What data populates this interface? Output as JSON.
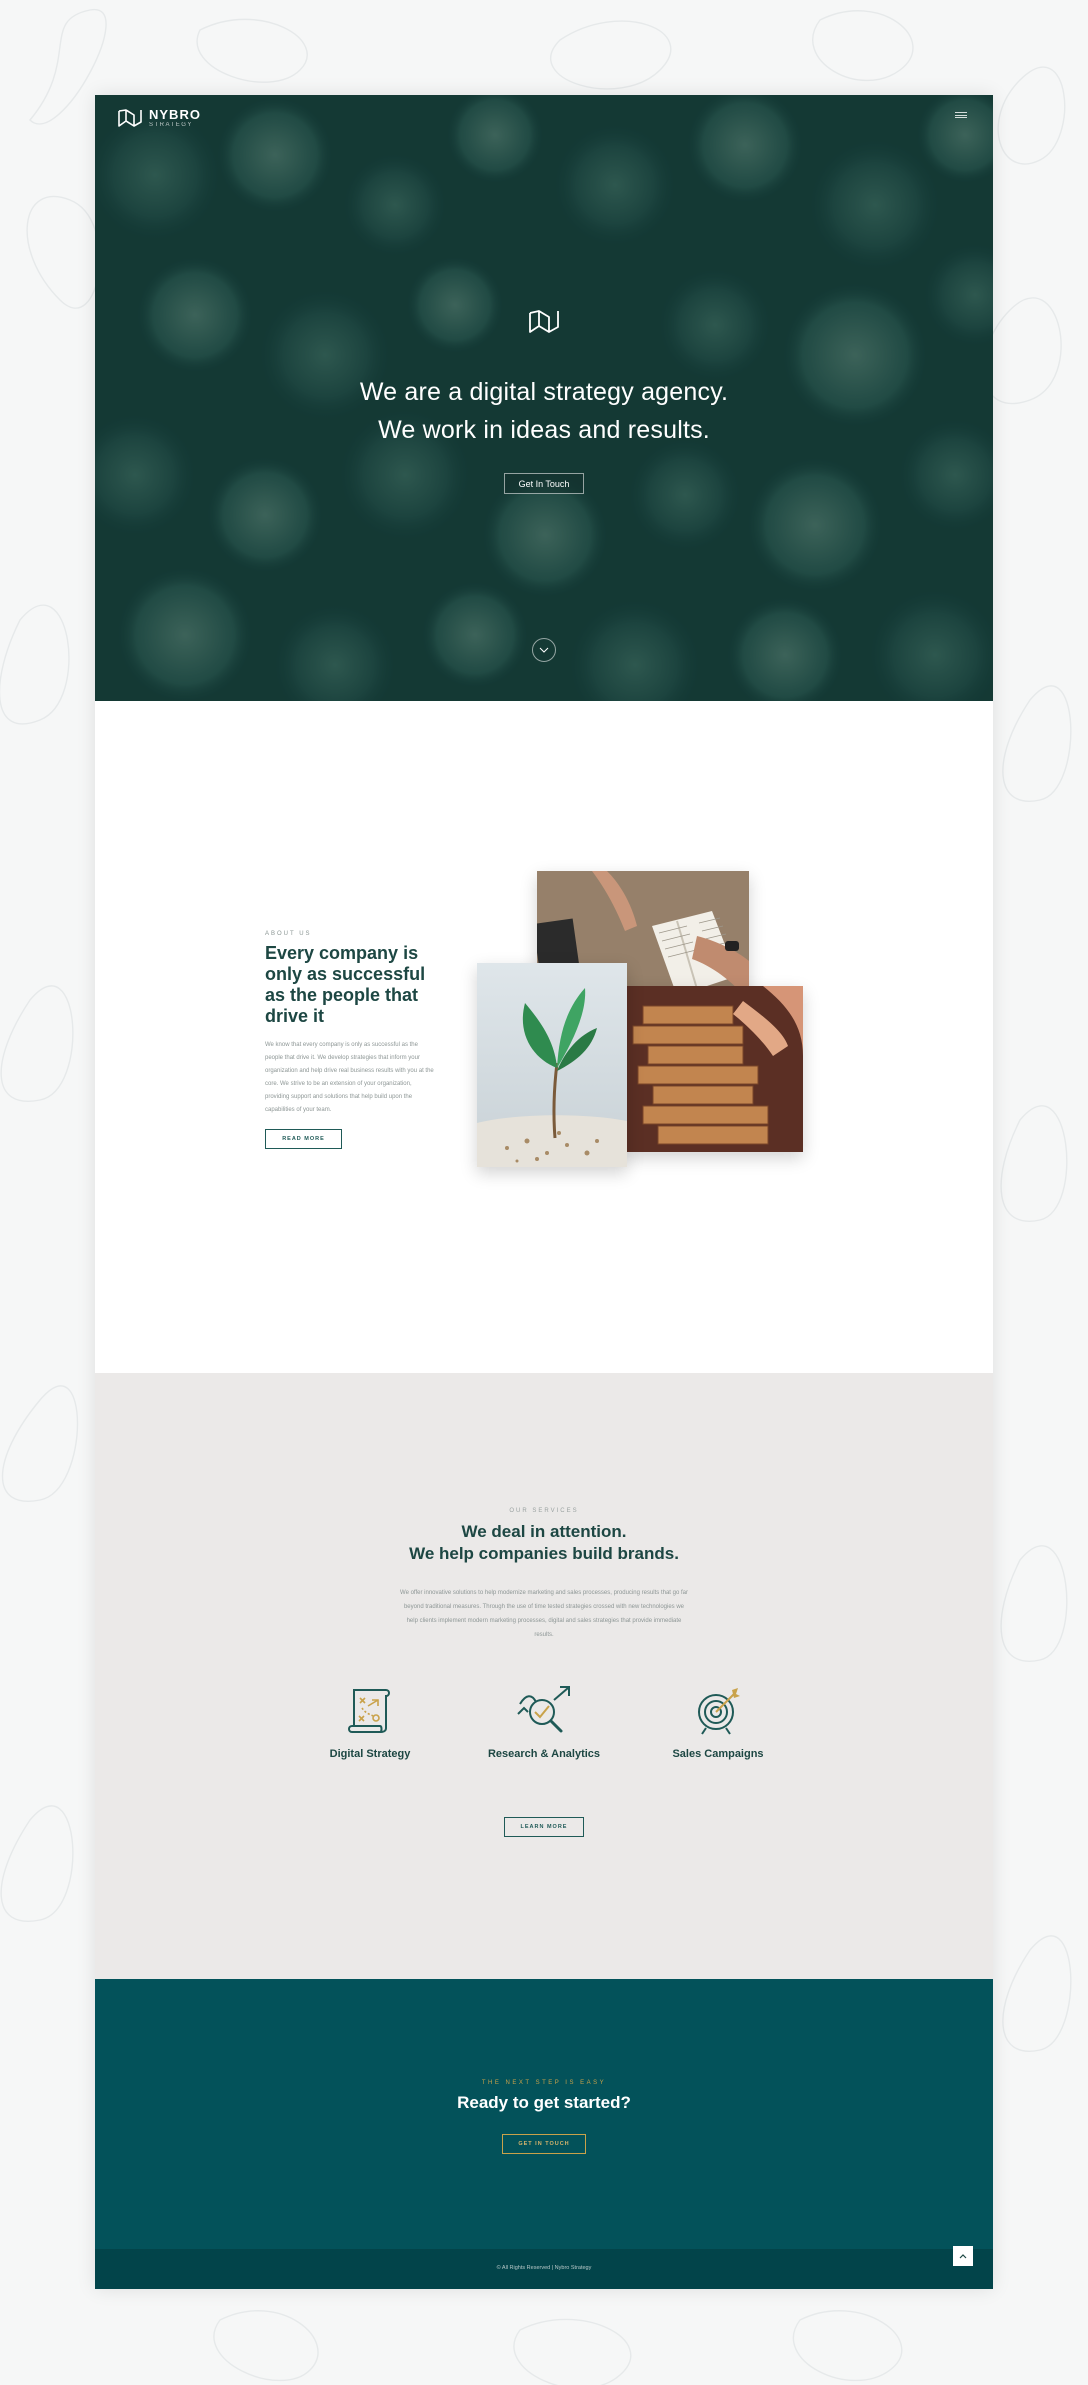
{
  "brand": {
    "name": "NYBRO",
    "tagline": "STRATEGY"
  },
  "hero": {
    "headline_line1": "We are a digital strategy agency.",
    "headline_line2": "We work in ideas and results.",
    "cta_label": "Get In Touch"
  },
  "about": {
    "eyebrow": "ABOUT US",
    "heading": "Every company is only as successful as the people that drive it",
    "body": "We know that every company is only as successful as the people that drive it. We develop strategies that inform your organization and help drive real business results with you at the core. We strive to be an extension of your organization, providing support and solutions that help build upon the capabilities of your team.",
    "button_label": "READ MORE"
  },
  "services": {
    "eyebrow": "OUR SERVICES",
    "heading_line1": "We deal in attention.",
    "heading_line2": "We help companies build brands.",
    "body": "We offer innovative solutions to help modernize marketing and sales processes, producing results that go far beyond traditional measures. Through the use of time tested strategies crossed with new technologies we help clients implement modern marketing processes, digital and sales strategies that provide immediate results.",
    "items": [
      {
        "label": "Digital Strategy",
        "icon": "strategy-map-icon"
      },
      {
        "label": "Research & Analytics",
        "icon": "research-analytics-icon"
      },
      {
        "label": "Sales Campaigns",
        "icon": "target-icon"
      }
    ],
    "button_label": "LEARN MORE"
  },
  "cta": {
    "eyebrow": "THE NEXT STEP IS EASY",
    "heading": "Ready to get started?",
    "button_label": "GET IN TOUCH"
  },
  "footer": {
    "copyright": "© All Rights Reserved | Nybro Strategy"
  },
  "colors": {
    "hero_bg": "#163d38",
    "primary_teal": "#1d4743",
    "cta_band": "#03525a",
    "footer_bg": "#02444a",
    "accent_gold": "#c9a24a",
    "services_bg": "#ebe9e8"
  }
}
